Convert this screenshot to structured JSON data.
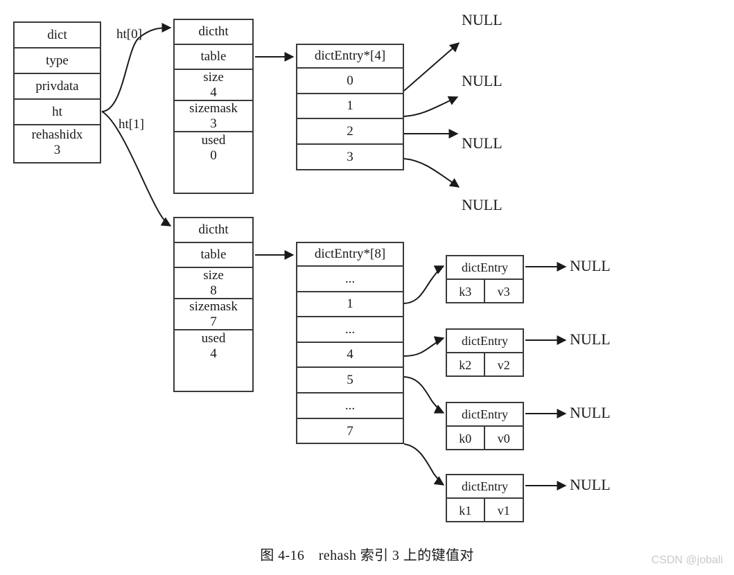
{
  "figure": {
    "caption": "图 4-16　rehash 索引 3 上的键值对",
    "watermark": "CSDN @jobali"
  },
  "dict": {
    "title": "dict",
    "fields": [
      {
        "name": "type",
        "value": ""
      },
      {
        "name": "privdata",
        "value": ""
      },
      {
        "name": "ht",
        "value": ""
      },
      {
        "name": "rehashidx",
        "value": "3"
      }
    ],
    "pointer_labels": {
      "ht0": "ht[0]",
      "ht1": "ht[1]"
    }
  },
  "hashtables": [
    {
      "id": "ht0",
      "title": "dictht",
      "fields": [
        {
          "name": "table",
          "value": ""
        },
        {
          "name": "size",
          "value": "4"
        },
        {
          "name": "sizemask",
          "value": "3"
        },
        {
          "name": "used",
          "value": "0"
        }
      ],
      "table": {
        "header": "dictEntry*[4]",
        "slots": [
          "0",
          "1",
          "2",
          "3"
        ],
        "slot_targets": [
          "NULL",
          "NULL",
          "NULL",
          "NULL"
        ]
      }
    },
    {
      "id": "ht1",
      "title": "dictht",
      "fields": [
        {
          "name": "table",
          "value": ""
        },
        {
          "name": "size",
          "value": "8"
        },
        {
          "name": "sizemask",
          "value": "7"
        },
        {
          "name": "used",
          "value": "4"
        }
      ],
      "table": {
        "header": "dictEntry*[8]",
        "slots": [
          "...",
          "1",
          "...",
          "4",
          "5",
          "...",
          "7"
        ]
      }
    }
  ],
  "entries": [
    {
      "title": "dictEntry",
      "key": "k3",
      "value": "v3",
      "next": "NULL"
    },
    {
      "title": "dictEntry",
      "key": "k2",
      "value": "v2",
      "next": "NULL"
    },
    {
      "title": "dictEntry",
      "key": "k0",
      "value": "v0",
      "next": "NULL"
    },
    {
      "title": "dictEntry",
      "key": "k1",
      "value": "v1",
      "next": "NULL"
    }
  ],
  "null_labels_ht0": [
    "NULL",
    "NULL",
    "NULL",
    "NULL"
  ],
  "colors": {
    "stroke": "#3a3a3a",
    "background": "#ffffff",
    "text": "#1a1a1a",
    "watermark": "#c9c9c9"
  }
}
